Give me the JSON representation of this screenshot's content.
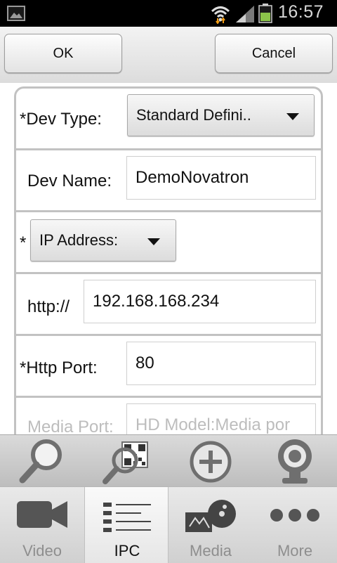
{
  "status_bar": {
    "time": "16:57",
    "icons": [
      "gallery-icon",
      "wifi-icon",
      "signal-icon",
      "battery-icon"
    ],
    "battery_color": "#8bc34a"
  },
  "top_buttons": {
    "ok_label": "OK",
    "cancel_label": "Cancel"
  },
  "form": {
    "dev_type": {
      "label": "*Dev Type:",
      "value": "Standard Defini.."
    },
    "dev_name": {
      "label": "Dev Name:",
      "value": "DemoNovatron"
    },
    "address": {
      "prefix": "*",
      "selector_value": "IP Address:"
    },
    "http": {
      "label": "http://",
      "value": "192.168.168.234"
    },
    "http_port": {
      "label": "*Http Port:",
      "value": "80"
    },
    "media_port": {
      "label": "Media Port:",
      "placeholder": "HD Model:Media por"
    }
  },
  "toolbar": {
    "icons": [
      "search-icon",
      "qr-scan-icon",
      "add-icon",
      "webcam-icon"
    ]
  },
  "tabs": [
    {
      "label": "Video",
      "icon": "video-camera-icon",
      "selected": false
    },
    {
      "label": "IPC",
      "icon": "list-icon",
      "selected": true
    },
    {
      "label": "Media",
      "icon": "media-icon",
      "selected": false
    },
    {
      "label": "More",
      "icon": "more-icon",
      "selected": false
    }
  ],
  "colors": {
    "icon_gray": "#6f6f6f",
    "form_border": "#c2c2c2",
    "selected_tab_text": "#111111",
    "tab_text": "#8e8e8e"
  }
}
